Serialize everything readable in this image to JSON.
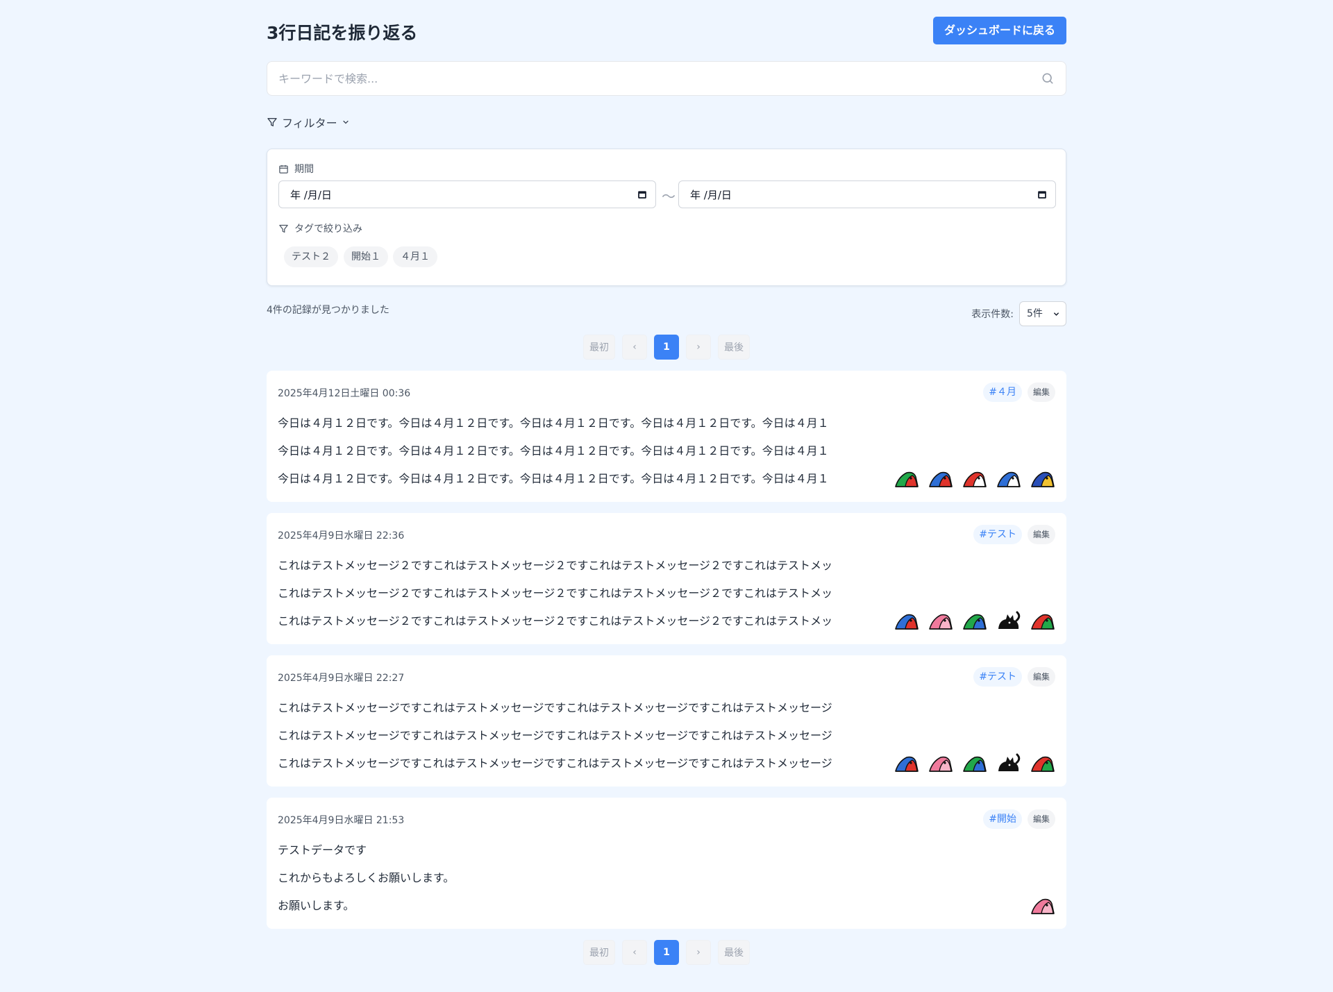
{
  "header": {
    "title": "3行日記を振り返る",
    "back_label": "ダッシュボードに戻る"
  },
  "search": {
    "placeholder": "キーワードで検索..."
  },
  "filter": {
    "toggle_label": "フィルター",
    "period_label": "期間",
    "date_from": "年 /月/日",
    "date_to": "年 /月/日",
    "range_sep": "～",
    "tag_label": "タグで絞り込み",
    "tags": [
      "テスト２",
      "開始１",
      "４月１"
    ]
  },
  "results": {
    "count_text": "4件の記録が見つかりました",
    "perpage_label": "表示件数:",
    "perpage_value": "5件"
  },
  "pagination": {
    "first": "最初",
    "prev": "‹",
    "current": "1",
    "next": "›",
    "last": "最後"
  },
  "entries": [
    {
      "date": "2025年4月12日土曜日 00:36",
      "tag": "#４月",
      "edit": "編集",
      "lines": [
        "今日は４月１２日です。今日は４月１２日です。今日は４月１２日です。今日は４月１２日です。今日は４月１",
        "今日は４月１２日です。今日は４月１２日です。今日は４月１２日です。今日は４月１２日です。今日は４月１",
        "今日は４月１２日です。今日は４月１２日です。今日は４月１２日です。今日は４月１２日です。今日は４月１"
      ],
      "stamps": [
        "bird-green-red",
        "bird-blue-red",
        "bird-red-white",
        "bird-blue-white",
        "bird-blue-yellow"
      ]
    },
    {
      "date": "2025年4月9日水曜日 22:36",
      "tag": "#テスト",
      "edit": "編集",
      "lines": [
        "これはテストメッセージ２ですこれはテストメッセージ２ですこれはテストメッセージ２ですこれはテストメッ",
        "これはテストメッセージ２ですこれはテストメッセージ２ですこれはテストメッセージ２ですこれはテストメッ",
        "これはテストメッセージ２ですこれはテストメッセージ２ですこれはテストメッセージ２ですこれはテストメッ"
      ],
      "stamps": [
        "bird-blue-red",
        "bird-pink",
        "bird-green-blue",
        "cat-black",
        "bird-red-green"
      ]
    },
    {
      "date": "2025年4月9日水曜日 22:27",
      "tag": "#テスト",
      "edit": "編集",
      "lines": [
        "これはテストメッセージですこれはテストメッセージですこれはテストメッセージですこれはテストメッセージ",
        "これはテストメッセージですこれはテストメッセージですこれはテストメッセージですこれはテストメッセージ",
        "これはテストメッセージですこれはテストメッセージですこれはテストメッセージですこれはテストメッセージ"
      ],
      "stamps": [
        "bird-blue-red",
        "bird-pink",
        "bird-green-blue",
        "cat-black",
        "bird-red-green"
      ]
    },
    {
      "date": "2025年4月9日水曜日 21:53",
      "tag": "#開始",
      "edit": "編集",
      "lines": [
        "テストデータです",
        "これからもよろしくお願いします。",
        "お願いします。"
      ],
      "stamps": [
        "bird-pink"
      ]
    }
  ],
  "colors": {
    "background": "#eff6ff",
    "accent": "#3b82f6",
    "tag_bg": "#eff6ff"
  }
}
